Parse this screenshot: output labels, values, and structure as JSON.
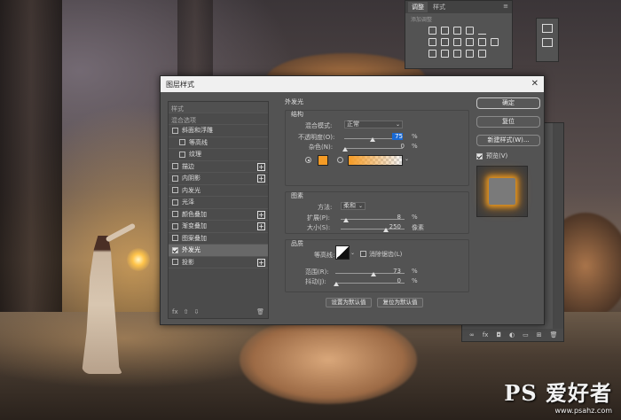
{
  "adjustments_panel": {
    "tabs": [
      "调整",
      "样式"
    ],
    "subtitle": "添加调整"
  },
  "watermark": {
    "main": "PS 爱好者",
    "sub": "www.psahz.com"
  },
  "dialog": {
    "title": "图层样式",
    "close_label": "✕",
    "left_list": {
      "header": "样式",
      "blend_options": "混合选项",
      "items": [
        {
          "label": "斜面和浮雕",
          "checked": false,
          "indent": false,
          "plus": false
        },
        {
          "label": "等高线",
          "checked": false,
          "indent": true,
          "plus": false
        },
        {
          "label": "纹理",
          "checked": false,
          "indent": true,
          "plus": false
        },
        {
          "label": "描边",
          "checked": false,
          "indent": false,
          "plus": true
        },
        {
          "label": "内阴影",
          "checked": false,
          "indent": false,
          "plus": true
        },
        {
          "label": "内发光",
          "checked": false,
          "indent": false,
          "plus": false
        },
        {
          "label": "光泽",
          "checked": false,
          "indent": false,
          "plus": false
        },
        {
          "label": "颜色叠加",
          "checked": false,
          "indent": false,
          "plus": true
        },
        {
          "label": "渐变叠加",
          "checked": false,
          "indent": false,
          "plus": true
        },
        {
          "label": "图案叠加",
          "checked": false,
          "indent": false,
          "plus": false
        },
        {
          "label": "外发光",
          "checked": true,
          "indent": false,
          "plus": false,
          "selected": true
        },
        {
          "label": "投影",
          "checked": false,
          "indent": false,
          "plus": true
        }
      ],
      "footer_fx": "fx"
    },
    "outer_glow": {
      "title": "外发光",
      "structure": {
        "title": "结构",
        "blend_mode_label": "混合模式:",
        "blend_mode_value": "正常",
        "opacity_label": "不透明度(O):",
        "opacity_value": "75",
        "opacity_unit": "%",
        "noise_label": "杂色(N):",
        "noise_value": "0",
        "noise_unit": "%",
        "glow_color": "#f59b25"
      },
      "elements": {
        "title": "图素",
        "method_label": "方法:",
        "method_value": "柔和",
        "spread_label": "扩展(P):",
        "spread_value": "8",
        "spread_unit": "%",
        "size_label": "大小(S):",
        "size_value": "250",
        "size_unit": "像素"
      },
      "quality": {
        "title": "品质",
        "contour_label": "等高线:",
        "anti_alias_label": "消除锯齿(L)",
        "range_label": "范围(R):",
        "range_value": "73",
        "range_unit": "%",
        "jitter_label": "抖动(J):",
        "jitter_value": "0",
        "jitter_unit": "%"
      },
      "make_default": "设置为默认值",
      "reset_default": "复位为默认值"
    },
    "buttons": {
      "ok": "确定",
      "reset": "复位",
      "new_style": "新建样式(W)...",
      "preview_label": "预览(V)"
    }
  }
}
